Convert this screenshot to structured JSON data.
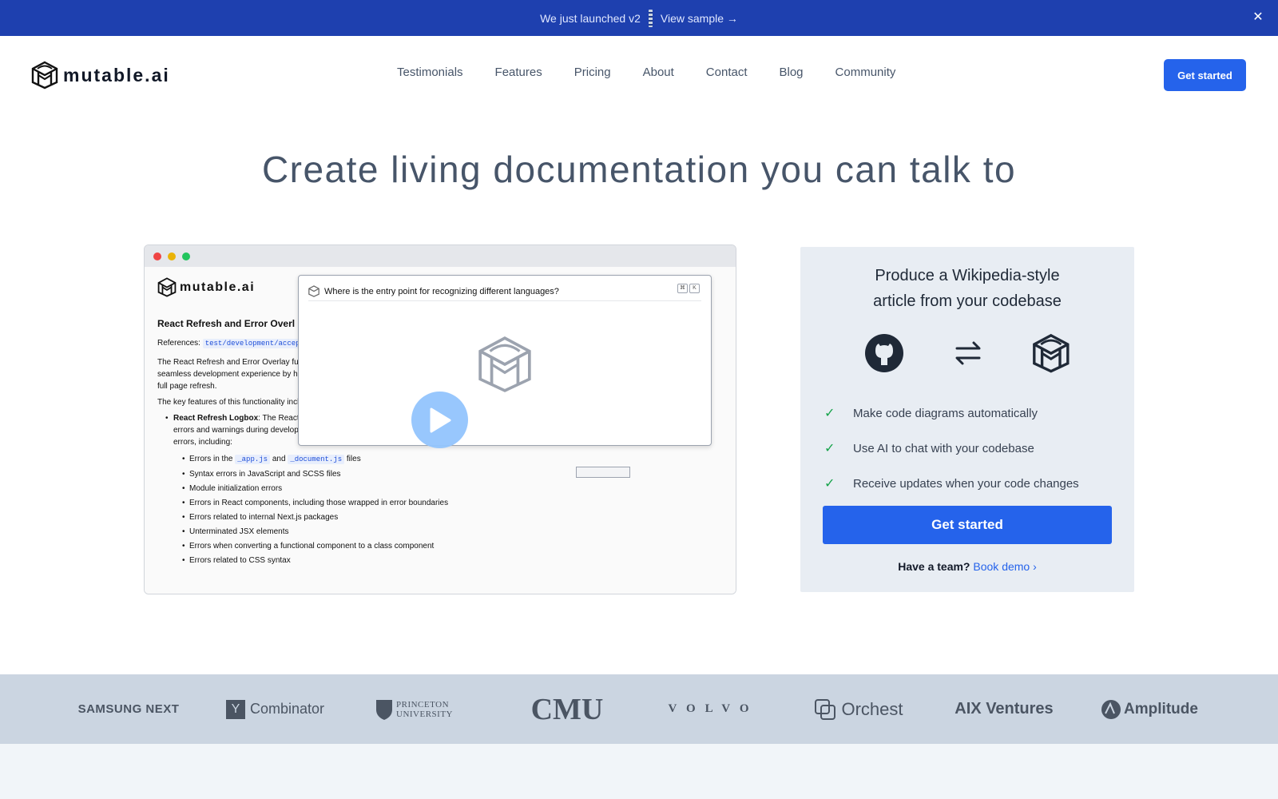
{
  "banner": {
    "text": "We just launched v2",
    "link": "View sample →",
    "close": "✕"
  },
  "nav": {
    "brand": "mutable.ai",
    "links": [
      "Testimonials",
      "Features",
      "Pricing",
      "About",
      "Contact",
      "Blog",
      "Community"
    ],
    "cta": "Get started"
  },
  "hero": {
    "title": "Create living documentation you can talk to"
  },
  "demo": {
    "brand": "mutable.ai",
    "doc_title": "React Refresh and Error Overl",
    "refs_label": "References:",
    "refs_code": "test/development/accept",
    "para1": "The React Refresh and Error Overlay fu",
    "para1b": "seamless development experience by ha",
    "para1c": "full page refresh.",
    "para2": "The key features of this functionality incl",
    "logbox_title": "React Refresh Logbox",
    "logbox_text": ": The React",
    "logbox_line2": "errors and warnings during develop",
    "logbox_line3": "errors, including:",
    "bullet_pre": "Errors in the",
    "bullet_code1": "_app.js",
    "bullet_and": "and",
    "bullet_code2": "_document.js",
    "bullet_post": "files",
    "bullets": [
      "Syntax errors in JavaScript and SCSS files",
      "Module initialization errors",
      "Errors in React components, including those wrapped in error boundaries",
      "Errors related to internal Next.js packages",
      "Unterminated JSX elements",
      "Errors when converting a functional component to a class component",
      "Errors related to CSS syntax"
    ],
    "popup_question": "Where is the entry point for recognizing different languages?",
    "kbd1": "⌘",
    "kbd2": "K"
  },
  "card": {
    "title_line1": "Produce a Wikipedia-style",
    "title_line2": "article from your codebase",
    "features": [
      "Make code diagrams automatically",
      "Use AI to chat with your codebase",
      "Receive updates when your code changes"
    ],
    "cta": "Get started",
    "team_text": "Have a team?",
    "team_link": "Book demo ›"
  },
  "logos": [
    "SAMSUNG NEXT",
    "Combinator",
    "PRINCETON UNIVERSITY",
    "CMU",
    "VOLVO",
    "Orchest",
    "AIX Ventures",
    "Amplitude"
  ],
  "colors": {
    "banner_bg": "#1e40af",
    "accent": "#2563eb",
    "check": "#16a34a",
    "logos_bg": "#cbd5e1"
  }
}
